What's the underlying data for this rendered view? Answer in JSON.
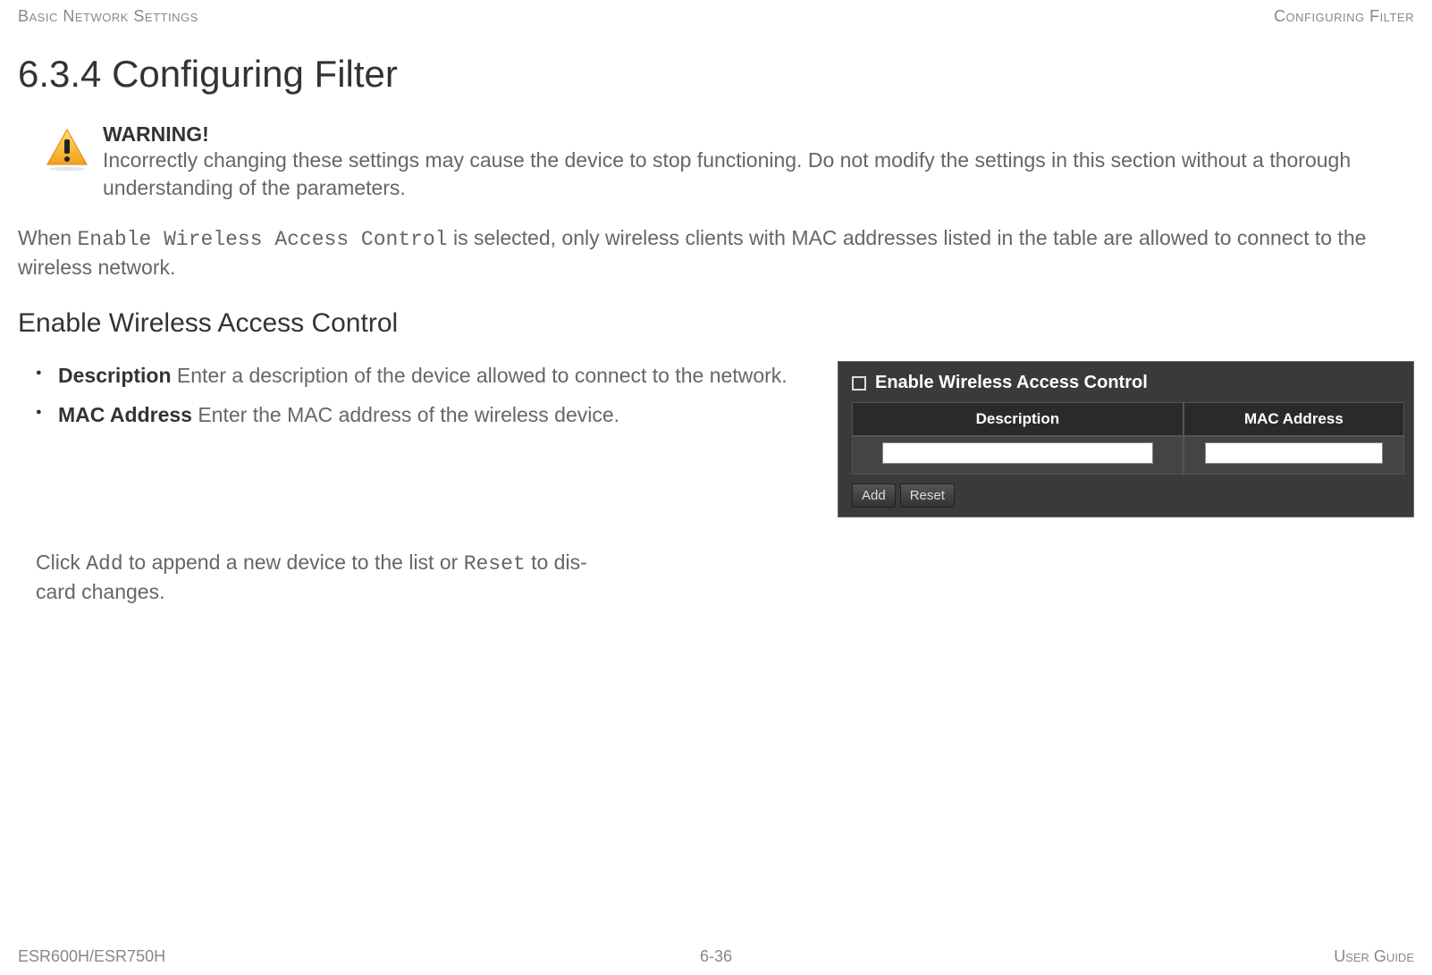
{
  "header": {
    "left": "Basic Network Settings",
    "right": "Configuring Filter"
  },
  "title": "6.3.4 Configuring Filter",
  "warning": {
    "label": "WARNING!",
    "body": "Incorrectly changing these settings may cause the device to stop functioning. Do not modify the settings in this section without a thorough understanding of the parameters."
  },
  "intro": {
    "prefix": "When ",
    "mono": "Enable Wireless Access Control",
    "suffix": " is selected, only wireless clients with MAC addresses listed in the table are allowed to connect to the wireless network."
  },
  "section": "Enable Wireless Access Control",
  "bullets": [
    {
      "term": "Description",
      "desc": "  Enter a description of the device allowed to connect to the network."
    },
    {
      "term": "MAC Address",
      "desc": "  Enter the MAC address of the wireless device."
    }
  ],
  "ui": {
    "checkbox_label": "Enable Wireless Access Control",
    "col1": "Description",
    "col2": "MAC Address",
    "add": "Add",
    "reset": "Reset"
  },
  "click": {
    "p1": "Click ",
    "m1": "Add",
    "p2": " to append a new device to the list or ",
    "m2": "Reset",
    "p3": " to dis-card changes."
  },
  "footer": {
    "left": "ESR600H/ESR750H",
    "center": "6-36",
    "right": "User Guide"
  }
}
